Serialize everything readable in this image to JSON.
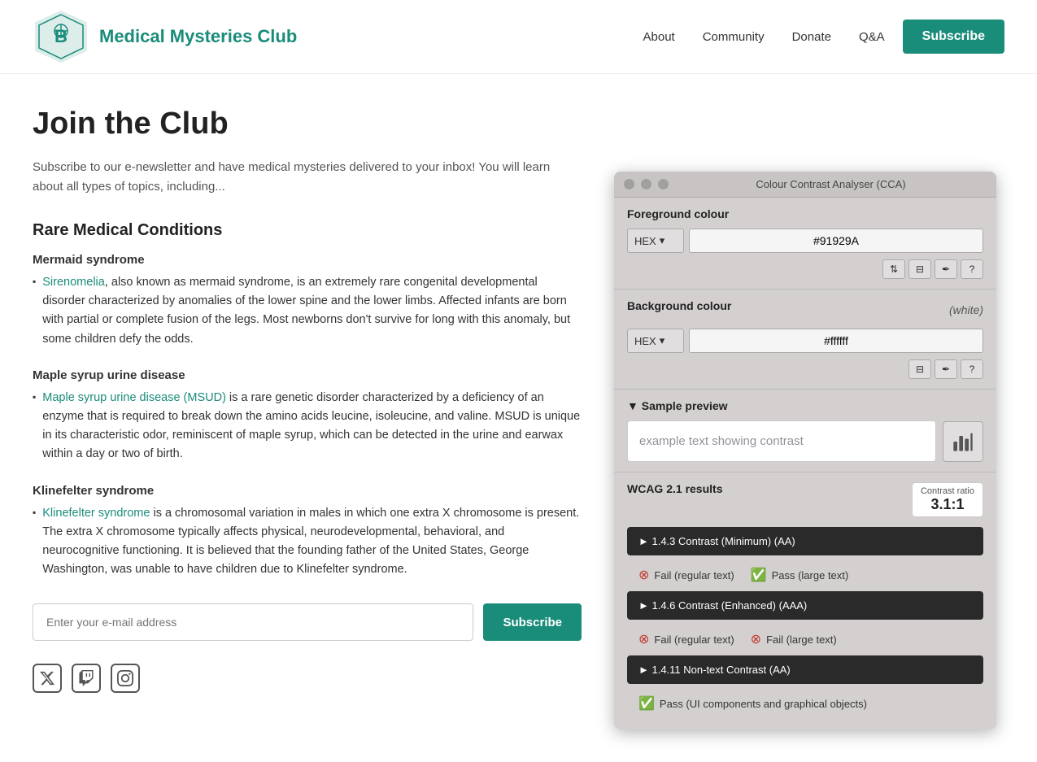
{
  "header": {
    "site_title": "Medical Mysteries Club",
    "nav": {
      "about": "About",
      "community": "Community",
      "donate": "Donate",
      "qa": "Q&A",
      "subscribe": "Subscribe"
    }
  },
  "main": {
    "page_title": "Join the Club",
    "intro": "Subscribe to our e-newsletter and have medical mysteries delivered to your inbox! You will learn about all types of topics, including...",
    "section_title": "Rare Medical Conditions",
    "conditions": [
      {
        "name": "Mermaid syndrome",
        "link_text": "Sirenomelia",
        "link_url": "#",
        "text": ", also known as mermaid syndrome, is an extremely rare congenital developmental disorder characterized by anomalies of the lower spine and the lower limbs. Affected infants are born with partial or complete fusion of the legs. Most newborns don't survive for long with this anomaly, but some children defy the odds."
      },
      {
        "name": "Maple syrup urine disease",
        "link_text": "Maple syrup urine disease (MSUD)",
        "link_url": "#",
        "text": " is a rare genetic disorder characterized by a deficiency of an enzyme that is required to break down the amino acids leucine, isoleucine, and valine. MSUD is unique in its characteristic odor, reminiscent of maple syrup, which can be detected in the urine and earwax within a day or two of birth."
      },
      {
        "name": "Klinefelter syndrome",
        "link_text": "Klinefelter syndrome",
        "link_url": "#",
        "text": " is a chromosomal variation in males in which one extra X chromosome is present. The extra X chromosome typically affects physical, neurodevelopmental, behavioral, and neurocognitive functioning. It is believed that the founding father of the United States, George Washington, was unable to have children due to Klinefelter syndrome."
      }
    ],
    "email_placeholder": "Enter your e-mail address",
    "subscribe_label": "Subscribe"
  },
  "social": {
    "twitter": "𝕏",
    "twitch": "📺",
    "instagram": "📷"
  },
  "cca": {
    "title": "Colour Contrast Analyser (CCA)",
    "foreground_label": "Foreground colour",
    "foreground_format": "HEX",
    "foreground_value": "#91929A",
    "background_label": "Background colour",
    "background_white": "(white)",
    "background_format": "HEX",
    "background_value": "#ffffff",
    "preview_label": "▼ Sample preview",
    "preview_text": "example text showing contrast",
    "wcag_label": "WCAG 2.1 results",
    "contrast_ratio_label": "Contrast ratio",
    "contrast_ratio_value": "3.1:1",
    "wcag_rows": [
      {
        "id": "144_3",
        "label": "► 1.4.3 Contrast (Minimum) (AA)",
        "results": [
          {
            "pass": false,
            "text": "Fail (regular text)"
          },
          {
            "pass": true,
            "text": "Pass (large text)"
          }
        ]
      },
      {
        "id": "144_6",
        "label": "► 1.4.6 Contrast (Enhanced) (AAA)",
        "results": [
          {
            "pass": false,
            "text": "Fail (regular text)"
          },
          {
            "pass": false,
            "text": "Fail (large text)"
          }
        ]
      },
      {
        "id": "144_11",
        "label": "► 1.4.11 Non-text Contrast (AA)",
        "results": [
          {
            "pass": true,
            "text": "Pass (UI components and graphical objects)"
          }
        ]
      }
    ]
  }
}
